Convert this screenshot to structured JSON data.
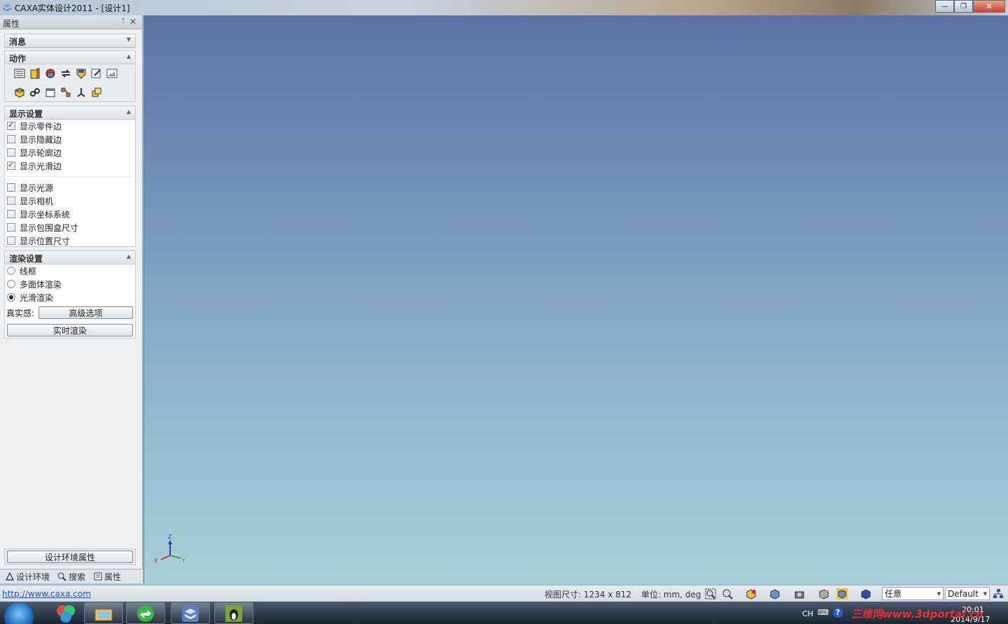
{
  "window": {
    "title": "CAXA实体设计2011 - [设计1]",
    "minimize": "—",
    "restore": "❐",
    "close": "✕"
  },
  "panel": {
    "title": "属性",
    "pin": "ᛘ",
    "close": "✕"
  },
  "sections": {
    "messages": {
      "title": "消息"
    },
    "actions": {
      "title": "动作"
    },
    "display": {
      "title": "显示设置",
      "items": [
        {
          "label": "显示零件边",
          "checked": true
        },
        {
          "label": "显示隐藏边",
          "checked": false
        },
        {
          "label": "显示轮廓边",
          "checked": false
        },
        {
          "label": "显示光滑边",
          "checked": true
        },
        {
          "label": "显示光源",
          "checked": false
        },
        {
          "label": "显示相机",
          "checked": false
        },
        {
          "label": "显示坐标系统",
          "checked": false
        },
        {
          "label": "显示包围盒尺寸",
          "checked": false
        },
        {
          "label": "显示位置尺寸",
          "checked": false
        }
      ]
    },
    "render": {
      "title": "渲染设置",
      "options": [
        {
          "label": "线框",
          "selected": false
        },
        {
          "label": "多面体渲染",
          "selected": false
        },
        {
          "label": "光滑渲染",
          "selected": true
        }
      ],
      "realism_label": "真实感:",
      "advanced_button": "高级选项",
      "realtime_button": "实时渲染"
    }
  },
  "env_props_button": "设计环境属性",
  "bottom_tabs": [
    {
      "label": "设计环境",
      "icon": "design-env-icon"
    },
    {
      "label": "搜索",
      "icon": "search-icon"
    },
    {
      "label": "属性",
      "icon": "properties-icon"
    }
  ],
  "axes": {
    "x": "X",
    "y": "Y",
    "z": "Z"
  },
  "status": {
    "link": "http://www.caxa.com",
    "view_size": "视图尺寸: 1234 x 812",
    "units": "单位: mm, deg",
    "filter_value": "任意",
    "style_value": "Default"
  },
  "taskbar": {
    "lang": "CH",
    "time": "20:01",
    "date": "2014/9/17",
    "watermark": "三维网www.3dportal.cn"
  },
  "colors": {
    "viewport_top": "#5b72a9",
    "viewport_bottom": "#a9cfd8",
    "link": "#1a4ec9"
  }
}
